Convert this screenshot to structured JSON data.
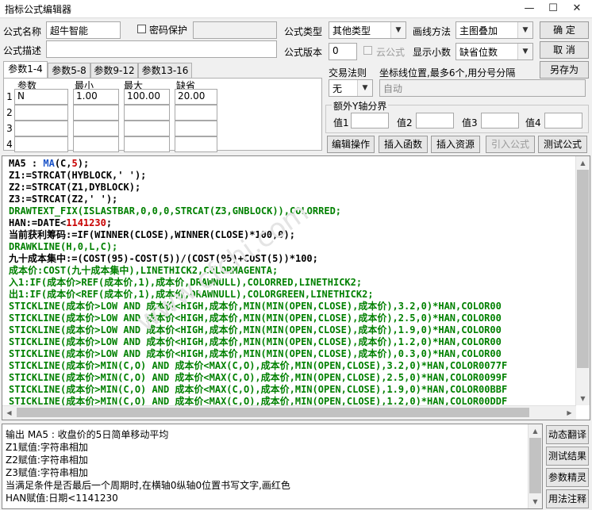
{
  "window": {
    "title": "指标公式编辑器",
    "minimize": "—",
    "maximize": "☐",
    "close": "✕"
  },
  "form": {
    "name_label": "公式名称",
    "name_value": "超牛智能",
    "password_label": "密码保护",
    "desc_label": "公式描述",
    "type_label": "公式类型",
    "type_value": "其他类型",
    "draw_label": "画线方法",
    "draw_value": "主图叠加",
    "version_label": "公式版本",
    "version_value": "0",
    "cloud_label": "云公式",
    "decimals_label": "显示小数",
    "decimals_value": "缺省位数",
    "trade_label": "交易法则",
    "trade_value": "无",
    "coord_label": "坐标线位置,最多6个,用分号分隔",
    "coord_value": "自动",
    "yaxis_label": "额外Y轴分界",
    "y1": "值1",
    "y2": "值2",
    "y3": "值3",
    "y4": "值4"
  },
  "buttons": {
    "ok": "确  定",
    "cancel": "取  消",
    "save_as": "另存为",
    "edit_op": "编辑操作",
    "insert_func": "插入函数",
    "insert_res": "插入资源",
    "import_formula": "引入公式",
    "test_formula": "测试公式"
  },
  "param_tabs": [
    "参数1-4",
    "参数5-8",
    "参数9-12",
    "参数13-16"
  ],
  "param_headers": [
    "参数",
    "最小",
    "最大",
    "缺省"
  ],
  "params": [
    {
      "num": "1",
      "name": "N",
      "min": "1.00",
      "max": "100.00",
      "def": "20.00"
    },
    {
      "num": "2",
      "name": "",
      "min": "",
      "max": "",
      "def": ""
    },
    {
      "num": "3",
      "name": "",
      "min": "",
      "max": "",
      "def": ""
    },
    {
      "num": "4",
      "name": "",
      "min": "",
      "max": "",
      "def": ""
    }
  ],
  "watermark": "www.cfchi.com",
  "code_lines": [
    [
      [
        "MA5 : ",
        "#000"
      ],
      [
        "MA",
        "#1a53c8"
      ],
      [
        "(C,",
        "#000"
      ],
      [
        "5",
        "#c80000"
      ],
      [
        ");",
        "#000"
      ]
    ],
    [
      [
        "Z1:=STRCAT(HYBLOCK,' ');",
        "#000"
      ]
    ],
    [
      [
        "Z2:=STRCAT(Z1,DYBLOCK);",
        "#000"
      ]
    ],
    [
      [
        "Z3:=STRCAT(Z2,' ');",
        "#000"
      ]
    ],
    [
      [
        "DRAWTEXT_FIX(ISLASTBAR,0,0,0,STRCAT(Z3,GNBLOCK)),COLORRED;",
        "#008000"
      ]
    ],
    [
      [
        "HAN:=DATE<",
        "#000"
      ],
      [
        "1141230",
        "#c80000"
      ],
      [
        ";",
        "#000"
      ]
    ],
    [
      [
        "当前获利筹码:=IF(WINNER(CLOSE),WINNER(CLOSE)*100,0);",
        "#000"
      ]
    ],
    [
      [
        "DRAWKLINE(H,0,L,C);",
        "#008000"
      ]
    ],
    [
      [
        "九十成本集中:=(COST(95)-COST(5))/(COST(95)+COST(5))*100;",
        "#000"
      ]
    ],
    [
      [
        "成本价:COST(九十成本集中),LINETHICK2,COLORMAGENTA;",
        "#008000"
      ]
    ],
    [
      [
        "入1:IF(成本价>REF(成本价,1),成本价,DRAWNULL),COLORRED,LINETHICK2;",
        "#008000"
      ]
    ],
    [
      [
        "出1:IF(成本价<REF(成本价,1),成本价,DRAWNULL),COLORGREEN,LINETHICK2;",
        "#008000"
      ]
    ],
    [
      [
        "STICKLINE(成本价>LOW AND 成本价<HIGH,成本价,MIN(MIN(OPEN,CLOSE),成本价),3.2,0)*HAN,COLOR00",
        "#008000"
      ]
    ],
    [
      [
        "STICKLINE(成本价>LOW AND 成本价<HIGH,成本价,MIN(MIN(OPEN,CLOSE),成本价),2.5,0)*HAN,COLOR00",
        "#008000"
      ]
    ],
    [
      [
        "STICKLINE(成本价>LOW AND 成本价<HIGH,成本价,MIN(MIN(OPEN,CLOSE),成本价),1.9,0)*HAN,COLOR00",
        "#008000"
      ]
    ],
    [
      [
        "STICKLINE(成本价>LOW AND 成本价<HIGH,成本价,MIN(MIN(OPEN,CLOSE),成本价),1.2,0)*HAN,COLOR00",
        "#008000"
      ]
    ],
    [
      [
        "STICKLINE(成本价>LOW AND 成本价<HIGH,成本价,MIN(MIN(OPEN,CLOSE),成本价),0.3,0)*HAN,COLOR00",
        "#008000"
      ]
    ],
    [
      [
        "STICKLINE(成本价>MIN(C,O) AND 成本价<MAX(C,O),成本价,MIN(OPEN,CLOSE),3.2,0)*HAN,COLOR0077F",
        "#008000"
      ]
    ],
    [
      [
        "STICKLINE(成本价>MIN(C,O) AND 成本价<MAX(C,O),成本价,MIN(OPEN,CLOSE),2.5,0)*HAN,COLOR0099F",
        "#008000"
      ]
    ],
    [
      [
        "STICKLINE(成本价>MIN(C,O) AND 成本价<MAX(C,O),成本价,MIN(OPEN,CLOSE),1.9,0)*HAN,COLOR00BBF",
        "#008000"
      ]
    ],
    [
      [
        "STICKLINE(成本价>MIN(C,O) AND 成本价<MAX(C,O),成本价,MIN(OPEN,CLOSE),1.2,0)*HAN,COLOR00DDF",
        "#008000"
      ]
    ]
  ],
  "output_lines": [
    "输出 MA5 : 收盘价的5日简单移动平均",
    "Z1赋值:字符串相加",
    "Z2赋值:字符串相加",
    "Z3赋值:字符串相加",
    "  当满足条件是否最后一个周期时,在横轴0纵轴0位置书写文字,画红色",
    "HAN赋值:日期<1141230"
  ],
  "side_buttons": [
    "动态翻译",
    "测试结果",
    "参数精灵",
    "用法注释"
  ]
}
